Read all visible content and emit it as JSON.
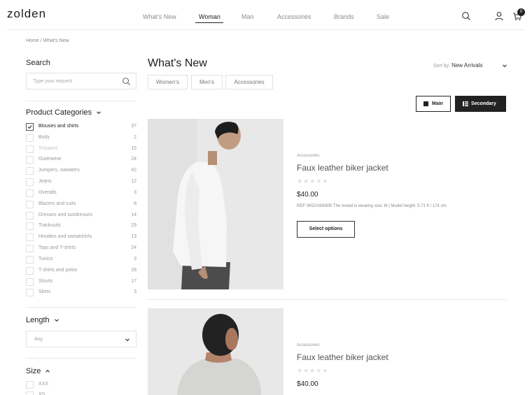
{
  "header": {
    "logo": "zolden",
    "nav": [
      "What's New",
      "Woman",
      "Man",
      "Accessories",
      "Brands",
      "Sale"
    ],
    "active_nav": "Woman",
    "cart_count": "0"
  },
  "breadcrumb": "Home / What's New",
  "sidebar": {
    "search_title": "Search",
    "search_placeholder": "Type your request",
    "categories_title": "Product Categories",
    "categories": [
      {
        "label": "Blouses and shirts",
        "count": "37",
        "checked": true
      },
      {
        "label": "Body",
        "count": "2"
      },
      {
        "label": "Trousers",
        "count": "15",
        "muted": true
      },
      {
        "label": "Outerwear",
        "count": "24"
      },
      {
        "label": "Jumpers, sweaters",
        "count": "42"
      },
      {
        "label": "Jeans",
        "count": "12"
      },
      {
        "label": "Overalls",
        "count": "3"
      },
      {
        "label": "Blazers and suits",
        "count": "8"
      },
      {
        "label": "Dresses and sundresses",
        "count": "14"
      },
      {
        "label": "Tracksuits",
        "count": "29"
      },
      {
        "label": "Hoodies and sweatshirts",
        "count": "13"
      },
      {
        "label": "Tops and T-shirts",
        "count": "24"
      },
      {
        "label": "Tunics",
        "count": "3"
      },
      {
        "label": "T-shirts and polos",
        "count": "28"
      },
      {
        "label": "Shorts",
        "count": "17"
      },
      {
        "label": "Skirts",
        "count": "3"
      }
    ],
    "length_title": "Length",
    "length_value": "Any",
    "size_title": "Size",
    "sizes": [
      "XXS",
      "XS"
    ]
  },
  "main": {
    "title": "What's New",
    "sort_label": "Sort by:",
    "sort_value": "New Arrivals",
    "filters": [
      "Women's",
      "Men's",
      "Accessories"
    ],
    "view_main": "Main",
    "view_secondary": "Secondary",
    "products": [
      {
        "category": "Accessories",
        "name": "Faux leather biker jacket",
        "price": "$40.00",
        "ref": "REF 0652/168/800 The model is wearing size: M | Model height: 5.71 ft / 174 cm",
        "button": "Select options"
      },
      {
        "category": "Accessories",
        "name": "Faux leather biker jacket",
        "price": "$40.00"
      }
    ]
  },
  "colors": {
    "accent": "#222222",
    "image_bg": "#e7e7e7"
  }
}
